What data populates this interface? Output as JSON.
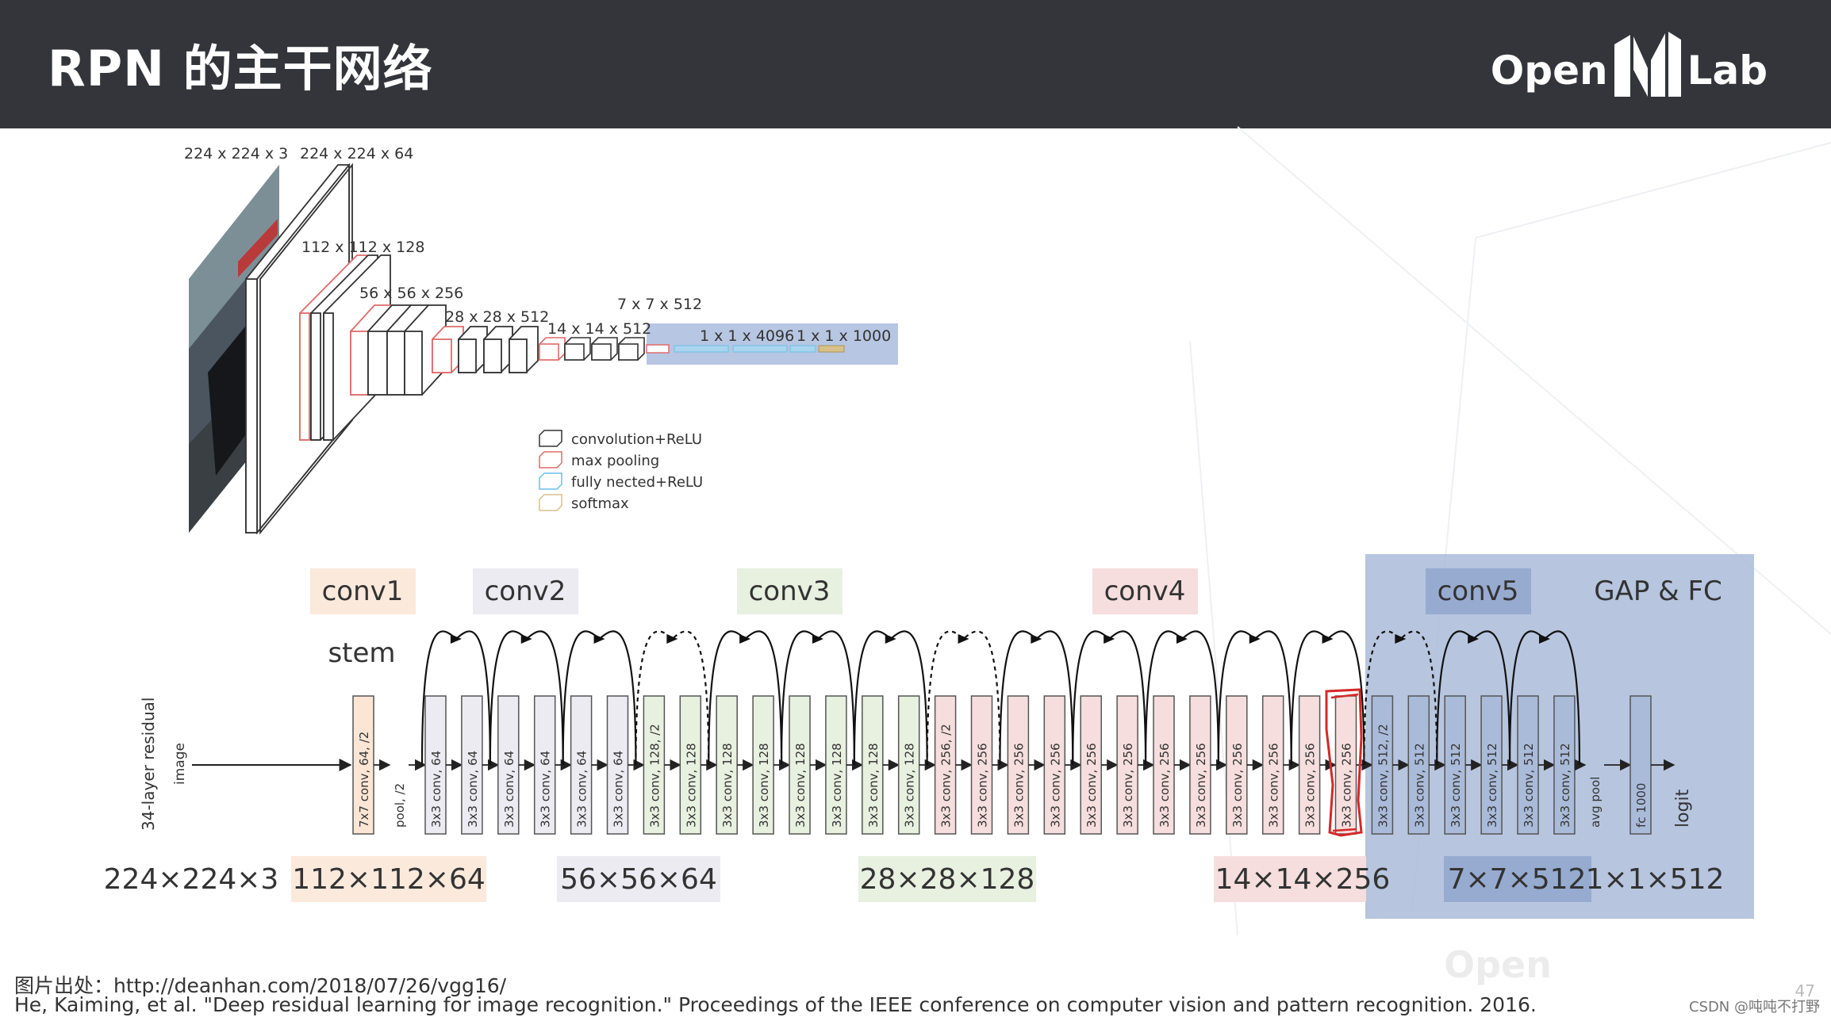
{
  "header": {
    "title": "RPN 的主干网络",
    "logo_left": "Open",
    "logo_right": "Lab",
    "logo_mark": "MM"
  },
  "vgg": {
    "labels": [
      "224 x 224 x 3",
      "224 x 224 x 64",
      "112 x 112 x 128",
      "56 x 56 x 256",
      "28 x 28 x 512",
      "14 x 14 x 512",
      "7 x 7 x 512",
      "1 x 1 x 4096",
      "1 x 1 x 1000"
    ],
    "legend": [
      {
        "label": "convolution+ReLU",
        "color": "#333333"
      },
      {
        "label": "max pooling",
        "color": "#e06a6a"
      },
      {
        "label": "fully nected+ReLU",
        "color": "#6cc0e8"
      },
      {
        "label": "softmax",
        "color": "#d8c08a"
      }
    ]
  },
  "resnet": {
    "vertical_caption": "34-layer residual",
    "input_label": "image",
    "stem_label": "stem",
    "stages": [
      {
        "name": "conv1",
        "color": "#fbe9dc",
        "size": "112×112×64"
      },
      {
        "name": "conv2",
        "color": "#ecebf2",
        "size": "56×56×64"
      },
      {
        "name": "conv3",
        "color": "#e8f0e0",
        "size": "28×28×128"
      },
      {
        "name": "conv4",
        "color": "#f5dedd",
        "size": "14×14×256"
      },
      {
        "name": "conv5",
        "color": "#aabbd9",
        "size": "7×7×512"
      },
      {
        "name": "GAP & FC",
        "color": "",
        "size": "1×1×512"
      }
    ],
    "input_size": "224×224×3",
    "layers": [
      {
        "label": "7x7 conv, 64, /2",
        "fill": "#fbe6d6"
      },
      {
        "label": "pool, /2",
        "fill": "none"
      },
      {
        "label": "3x3 conv, 64",
        "fill": "#ecebf2"
      },
      {
        "label": "3x3 conv, 64",
        "fill": "#ecebf2"
      },
      {
        "label": "3x3 conv, 64",
        "fill": "#ecebf2"
      },
      {
        "label": "3x3 conv, 64",
        "fill": "#ecebf2"
      },
      {
        "label": "3x3 conv, 64",
        "fill": "#ecebf2"
      },
      {
        "label": "3x3 conv, 64",
        "fill": "#ecebf2"
      },
      {
        "label": "3x3 conv, 128, /2",
        "fill": "#e8f0e0"
      },
      {
        "label": "3x3 conv, 128",
        "fill": "#e8f0e0"
      },
      {
        "label": "3x3 conv, 128",
        "fill": "#e8f0e0"
      },
      {
        "label": "3x3 conv, 128",
        "fill": "#e8f0e0"
      },
      {
        "label": "3x3 conv, 128",
        "fill": "#e8f0e0"
      },
      {
        "label": "3x3 conv, 128",
        "fill": "#e8f0e0"
      },
      {
        "label": "3x3 conv, 128",
        "fill": "#e8f0e0"
      },
      {
        "label": "3x3 conv, 128",
        "fill": "#e8f0e0"
      },
      {
        "label": "3x3 conv, 256, /2",
        "fill": "#f5dedd"
      },
      {
        "label": "3x3 conv, 256",
        "fill": "#f5dedd"
      },
      {
        "label": "3x3 conv, 256",
        "fill": "#f5dedd"
      },
      {
        "label": "3x3 conv, 256",
        "fill": "#f5dedd"
      },
      {
        "label": "3x3 conv, 256",
        "fill": "#f5dedd"
      },
      {
        "label": "3x3 conv, 256",
        "fill": "#f5dedd"
      },
      {
        "label": "3x3 conv, 256",
        "fill": "#f5dedd"
      },
      {
        "label": "3x3 conv, 256",
        "fill": "#f5dedd"
      },
      {
        "label": "3x3 conv, 256",
        "fill": "#f5dedd"
      },
      {
        "label": "3x3 conv, 256",
        "fill": "#f5dedd"
      },
      {
        "label": "3x3 conv, 256",
        "fill": "#f5dedd"
      },
      {
        "label": "3x3 conv, 256",
        "fill": "#f5dedd"
      },
      {
        "label": "3x3 conv, 512, /2",
        "fill": "#aabbd9"
      },
      {
        "label": "3x3 conv, 512",
        "fill": "#aabbd9"
      },
      {
        "label": "3x3 conv, 512",
        "fill": "#aabbd9"
      },
      {
        "label": "3x3 conv, 512",
        "fill": "#aabbd9"
      },
      {
        "label": "3x3 conv, 512",
        "fill": "#aabbd9"
      },
      {
        "label": "3x3 conv, 512",
        "fill": "#aabbd9"
      },
      {
        "label": "avg pool",
        "fill": "none"
      },
      {
        "label": "fc 1000",
        "fill": "#aabbd9"
      },
      {
        "label": "logit",
        "fill": "none"
      }
    ],
    "skip_arcs": 16,
    "highlight_color": "#d62828"
  },
  "footer": {
    "source": "图片出处：http://deanhan.com/2018/07/26/vgg16/",
    "citation": "He, Kaiming, et al. \"Deep residual learning for image recognition.\" Proceedings of the IEEE conference on computer vision and pattern recognition. 2016.",
    "watermark": "CSDN @吨吨不打野",
    "page": "47"
  }
}
